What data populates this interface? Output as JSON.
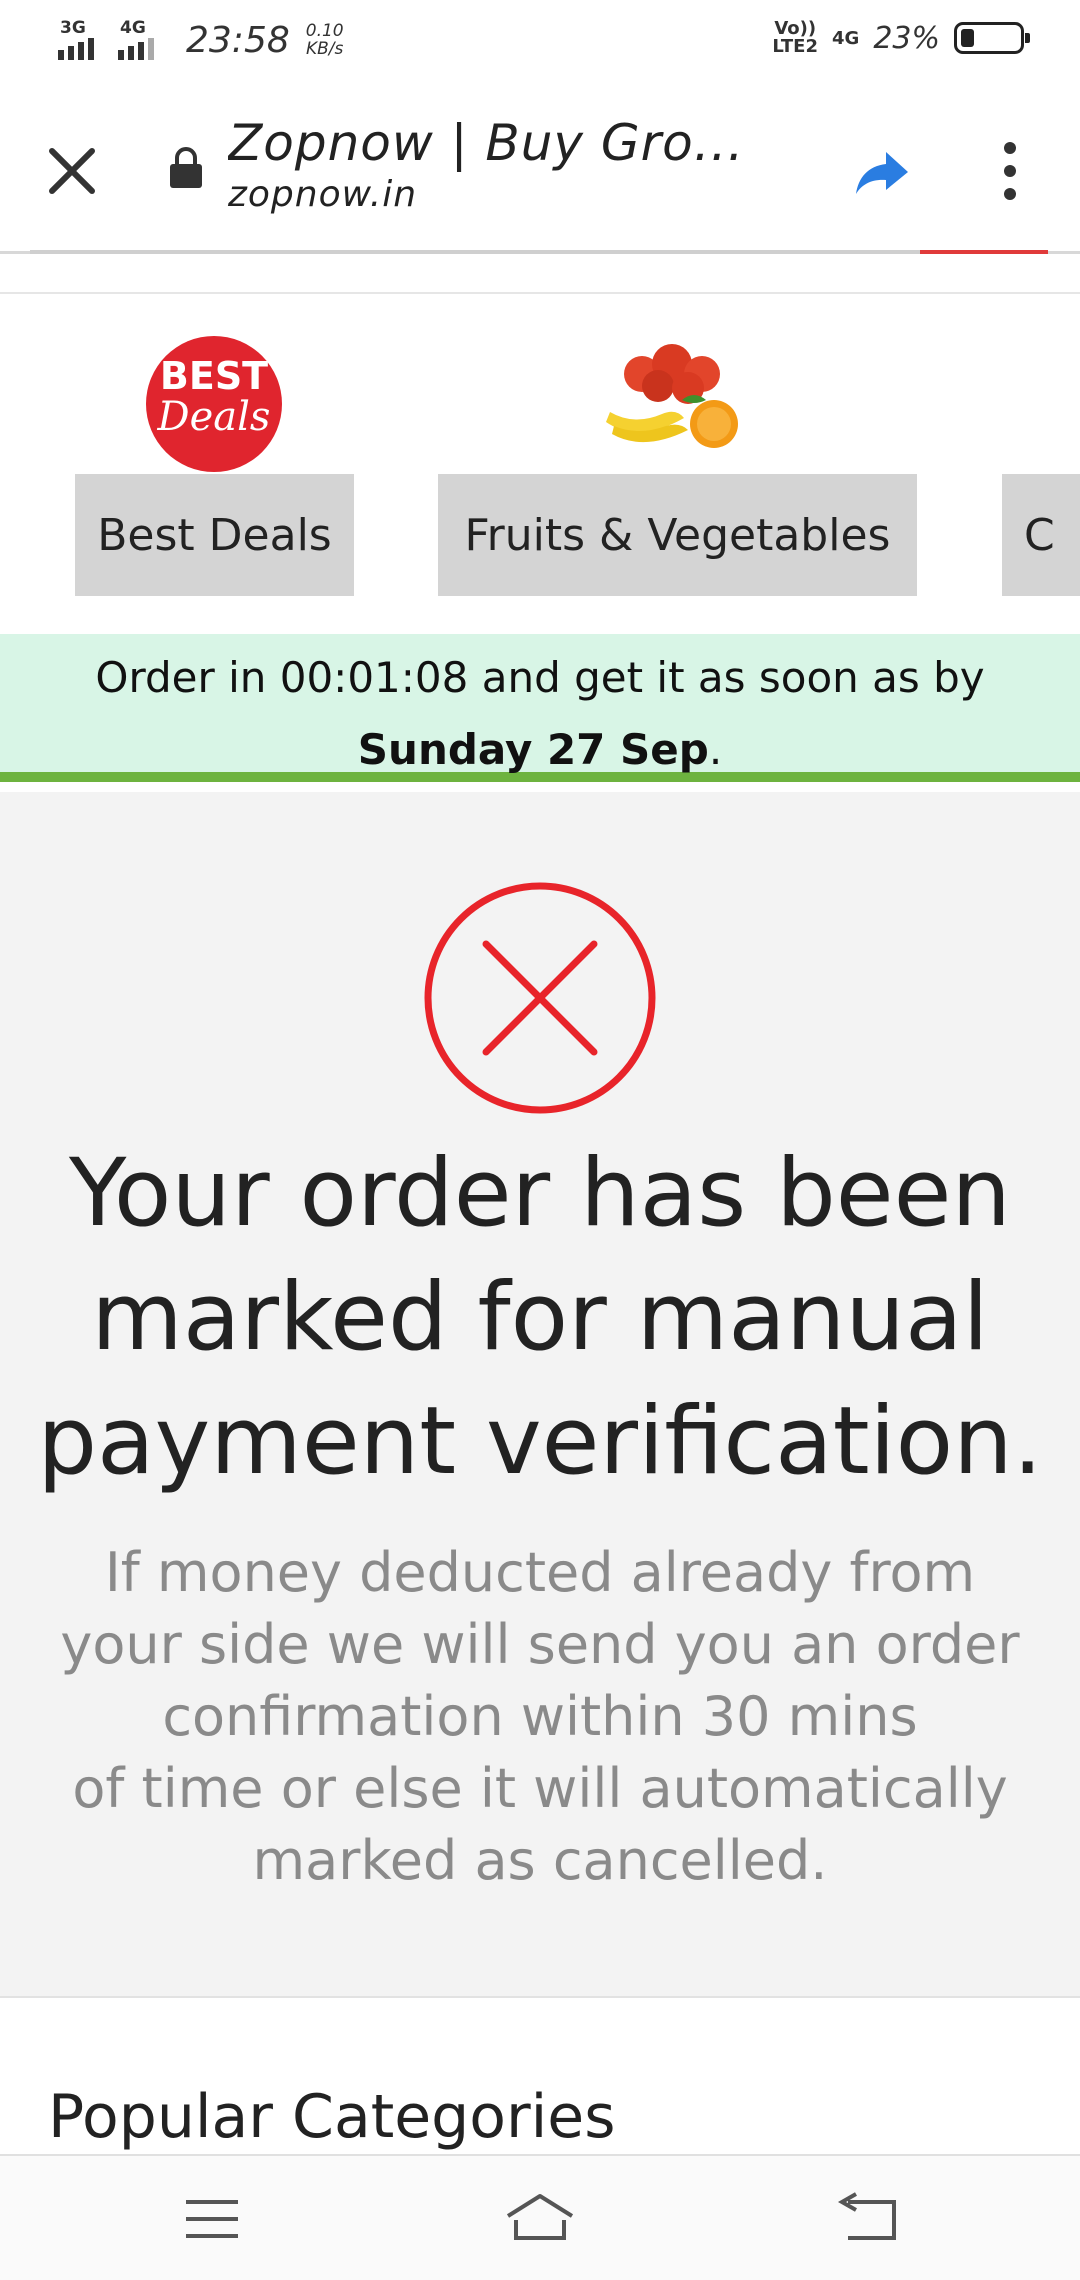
{
  "status_bar": {
    "sim1": "3G",
    "sim2": "4G",
    "time": "23:58",
    "speed_value": "0.10",
    "speed_unit": "KB/s",
    "volte_top": "Vo))",
    "volte_bottom": "LTE2",
    "network": "4G",
    "battery_text": "23%",
    "battery_level": 0.23
  },
  "browser": {
    "title": "Zopnow | Buy Gro...",
    "url": "zopnow.in"
  },
  "categories": [
    {
      "label": "Best Deals",
      "icon": "best-deals-icon"
    },
    {
      "label": "Fruits & Vegetables",
      "icon": "fruits-vegetables-image"
    },
    {
      "label": "C",
      "icon": ""
    }
  ],
  "badge": {
    "line1": "BEST",
    "line2": "Deals"
  },
  "order_banner": {
    "prefix": "Order in 00:01:08 and get it as soon as by ",
    "date": "Sunday 27 Sep",
    "suffix": "."
  },
  "status_message": {
    "headline": "Your order has been marked for manual payment verification.",
    "line1": "If money deducted already from your side we will send you an order confirmation within 30 mins",
    "line2": "of time or else it will automatically marked as cancelled."
  },
  "popular": {
    "title": "Popular Categories"
  },
  "colors": {
    "banner_bg": "#d8f5e6",
    "banner_border": "#6db33f",
    "error_red": "#e8242a",
    "share_blue": "#2a7de1"
  }
}
